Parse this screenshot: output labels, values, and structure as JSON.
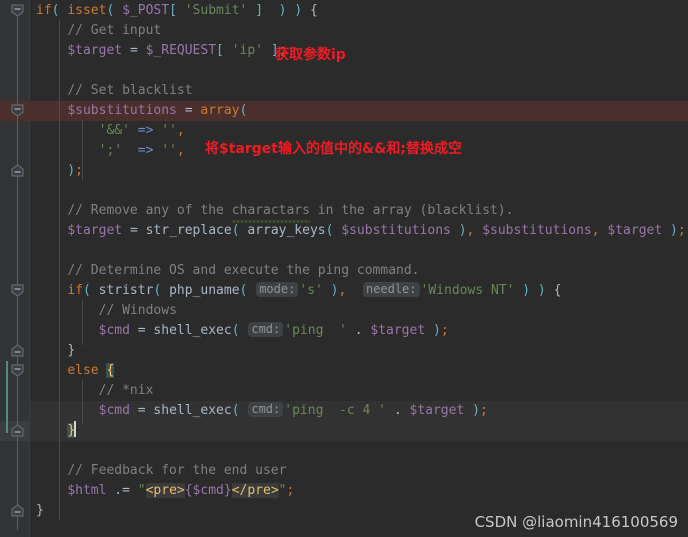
{
  "editor": {
    "language": "php",
    "theme": "darcula",
    "background": "#2b2b2b",
    "gutter_background": "#313335",
    "error_line_background": "#4b2f2c",
    "current_line_background": "#323232",
    "brace_match_color": "#3b514d",
    "caret_color": "#d4d4d4"
  },
  "code": {
    "lines": [
      {
        "n": 1,
        "text": "if( isset( $_POST[ 'Submit' ]  ) ) {"
      },
      {
        "n": 2,
        "text": "    // Get input"
      },
      {
        "n": 3,
        "text": "    $target = $_REQUEST[ 'ip' ];"
      },
      {
        "n": 4,
        "text": ""
      },
      {
        "n": 5,
        "text": "    // Set blacklist"
      },
      {
        "n": 6,
        "text": "    $substitutions = array("
      },
      {
        "n": 7,
        "text": "        '&&' => '',"
      },
      {
        "n": 8,
        "text": "        ';'  => '',"
      },
      {
        "n": 9,
        "text": "    );"
      },
      {
        "n": 10,
        "text": ""
      },
      {
        "n": 11,
        "text": "    // Remove any of the charactars in the array (blacklist)."
      },
      {
        "n": 12,
        "text": "    $target = str_replace( array_keys( $substitutions ), $substitutions, $target );"
      },
      {
        "n": 13,
        "text": ""
      },
      {
        "n": 14,
        "text": "    // Determine OS and execute the ping command."
      },
      {
        "n": 15,
        "text": "    if( stristr( php_uname( mode: 's' ),  needle: 'Windows NT' ) ) {"
      },
      {
        "n": 16,
        "text": "        // Windows"
      },
      {
        "n": 17,
        "text": "        $cmd = shell_exec( cmd: 'ping  ' . $target );"
      },
      {
        "n": 18,
        "text": "    }"
      },
      {
        "n": 19,
        "text": "    else {"
      },
      {
        "n": 20,
        "text": "        // *nix"
      },
      {
        "n": 21,
        "text": "        $cmd = shell_exec( cmd: 'ping  -c 4 ' . $target );"
      },
      {
        "n": 22,
        "text": "    }"
      },
      {
        "n": 23,
        "text": ""
      },
      {
        "n": 24,
        "text": "    // Feedback for the end user"
      },
      {
        "n": 25,
        "text": "    $html .= \"<pre>{$cmd}</pre>\";"
      },
      {
        "n": 26,
        "text": "}"
      }
    ],
    "tokens": {
      "kw_if": "if",
      "kw_else": "else",
      "fn_isset": "isset",
      "fn_array": "array",
      "fn_str_replace": "str_replace",
      "fn_array_keys": "array_keys",
      "fn_stristr": "stristr",
      "fn_php_uname": "php_uname",
      "fn_shell_exec": "shell_exec",
      "var_post": "$_POST",
      "var_request": "$_REQUEST",
      "var_target": "$target",
      "var_substitutions": "$substitutions",
      "var_cmd": "$cmd",
      "var_html": "$html",
      "str_submit": "'Submit'",
      "str_ip": "'ip'",
      "str_amp": "'&&'",
      "str_semi": "';'",
      "str_empty": "''",
      "str_s": "'s'",
      "str_windows_nt": "'Windows NT'",
      "str_ping": "'ping  '",
      "str_ping_c4": "'ping  -c 4 '",
      "arrow": "=>",
      "concat": ".",
      "assign": "=",
      "append": ".=",
      "misspelled_word": "charactars"
    },
    "parameter_hints": [
      {
        "label": "mode:",
        "line": 15
      },
      {
        "label": "needle:",
        "line": 15
      },
      {
        "label": "cmd:",
        "line": 17
      },
      {
        "label": "cmd:",
        "line": 21
      }
    ],
    "comments": [
      "// Get input",
      "// Set blacklist",
      "// Remove any of the charactars in the array (blacklist).",
      "// Determine OS and execute the ping command.",
      "// Windows",
      "// *nix",
      "// Feedback for the end user"
    ]
  },
  "annotations": [
    {
      "id": "anno-1",
      "text": "获取参数ip",
      "color": "#ec1c24"
    },
    {
      "id": "anno-2",
      "text": "将$target输入的值中的&&和;替换成空",
      "color": "#ec1c24"
    }
  ],
  "watermark": {
    "text": "CSDN @liaomin416100569"
  },
  "gutter": {
    "fold_markers": [
      {
        "type": "fold-open",
        "line": 1
      },
      {
        "type": "fold-open",
        "line": 6
      },
      {
        "type": "fold-close",
        "line": 9
      },
      {
        "type": "fold-open",
        "line": 15
      },
      {
        "type": "fold-close",
        "line": 18
      },
      {
        "type": "fold-open",
        "line": 19
      },
      {
        "type": "fold-close",
        "line": 22
      },
      {
        "type": "fold-close",
        "line": 26
      }
    ]
  }
}
